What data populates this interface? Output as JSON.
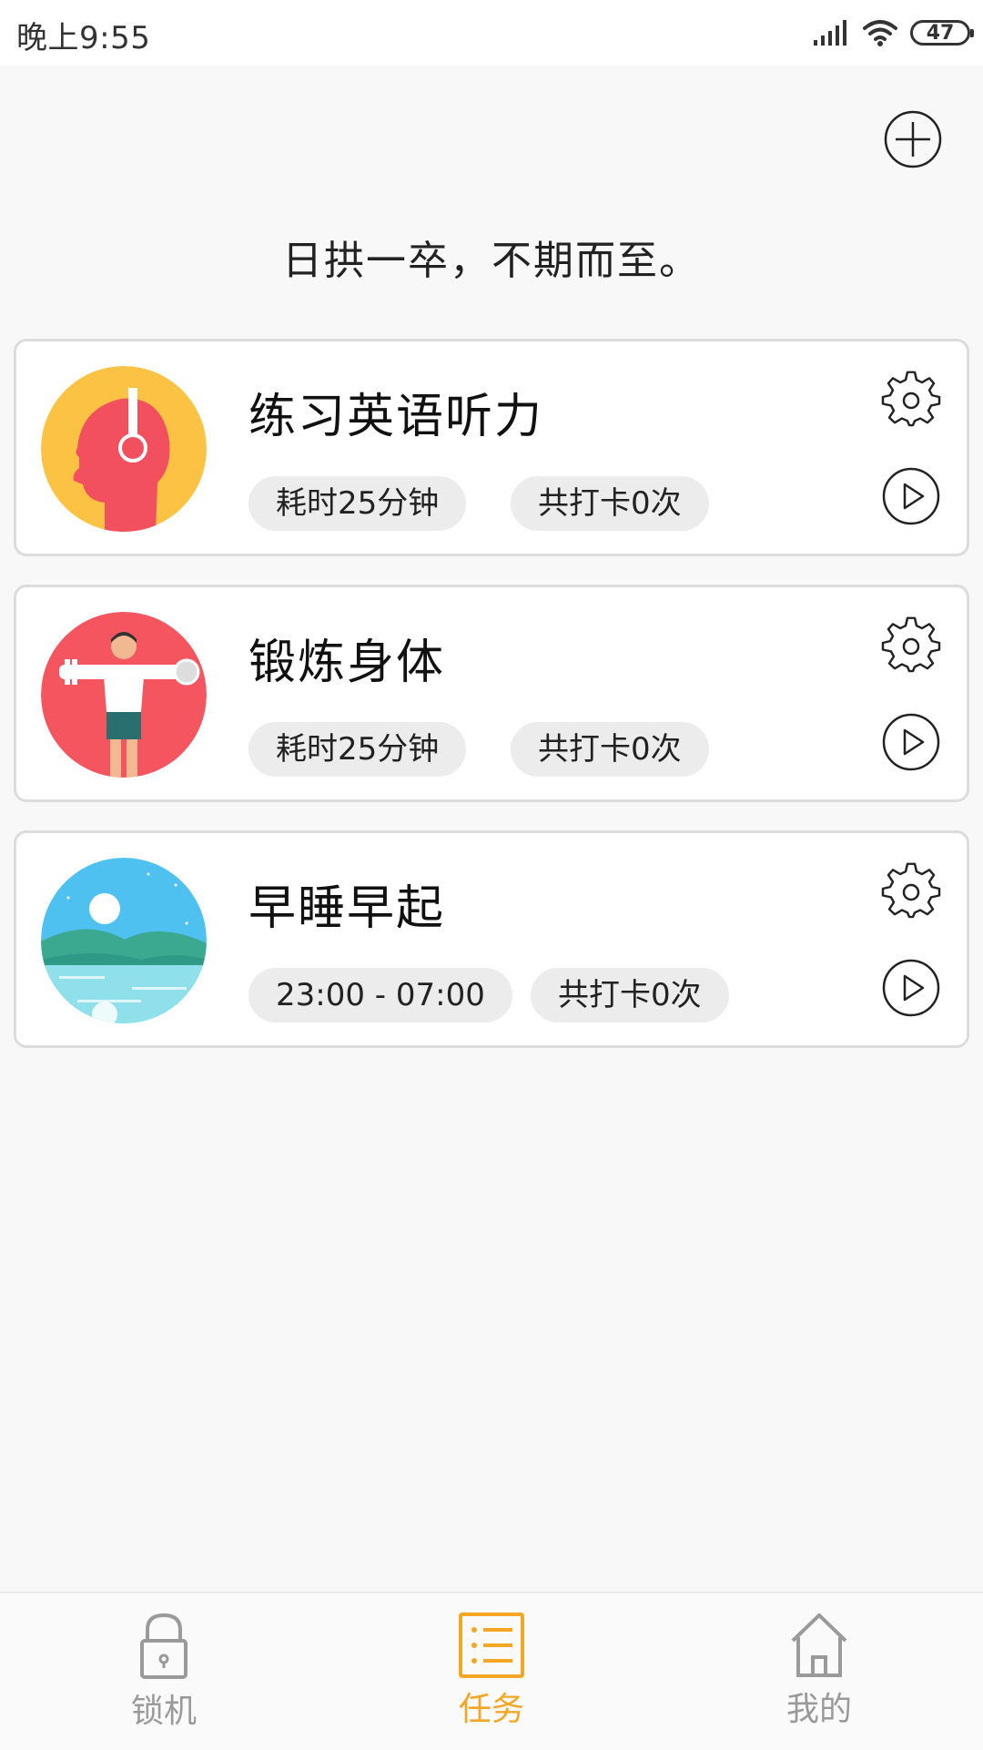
{
  "status_bar": {
    "time": "晚上9:55",
    "battery": "47"
  },
  "motto": "日拱一卒，不期而至。",
  "tasks": [
    {
      "title": "练习英语听力",
      "duration": "耗时25分钟",
      "checkins": "共打卡0次",
      "avatar": "headphones-head-icon"
    },
    {
      "title": "锻炼身体",
      "duration": "耗时25分钟",
      "checkins": "共打卡0次",
      "avatar": "dumbbell-man-icon"
    },
    {
      "title": "早睡早起",
      "duration": "23:00 - 07:00",
      "checkins": "共打卡0次",
      "avatar": "moon-lake-icon"
    }
  ],
  "nav": {
    "lock": "锁机",
    "tasks": "任务",
    "mine": "我的",
    "active": "tasks"
  },
  "colors": {
    "accent": "#f5a623",
    "background": "#f8f8f8",
    "chip": "#ececec"
  }
}
